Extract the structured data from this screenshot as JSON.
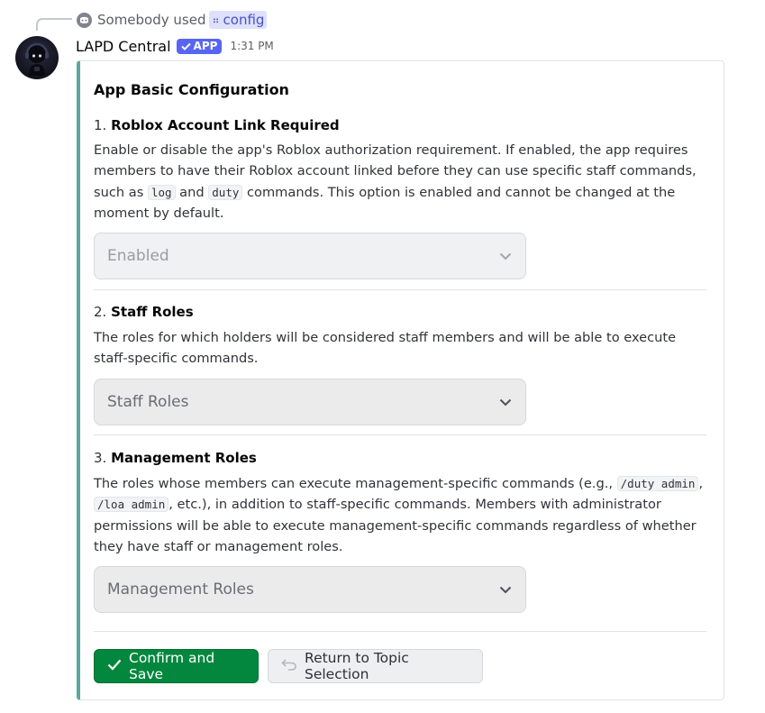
{
  "reply": {
    "text": "Somebody used",
    "command": "config"
  },
  "message": {
    "username": "LAPD Central",
    "app_tag": "APP",
    "timestamp": "1:31 PM"
  },
  "embed": {
    "accent_color": "#5aa89e",
    "title": "App Basic Configuration",
    "sections": [
      {
        "number": "1.",
        "heading": "Roblox Account Link Required",
        "text_parts": [
          "Enable or disable the app's Roblox authorization requirement. If enabled, the app requires members to have their Roblox account linked before they can use specific staff commands, such as ",
          "log",
          " and ",
          "duty",
          " commands. This option is enabled and cannot be changed at the moment by default."
        ],
        "select_value": "Enabled",
        "select_disabled": true
      },
      {
        "number": "2.",
        "heading": "Staff Roles",
        "text": "The roles for which holders will be considered staff members and will be able to execute staff-specific commands.",
        "select_placeholder": "Staff Roles"
      },
      {
        "number": "3.",
        "heading": "Management Roles",
        "text_parts": [
          "The roles whose members can execute management-specific commands (e.g., ",
          "/duty admin",
          ", ",
          "/loa admin",
          ", etc.), in addition to staff-specific commands. Members with administrator permissions will be able to execute management-specific commands regardless of whether they have staff or management roles."
        ],
        "select_placeholder": "Management Roles"
      }
    ]
  },
  "buttons": {
    "confirm": "Confirm and Save",
    "confirm_color": "#03873e",
    "return": "Return to Topic Selection"
  },
  "icons": {
    "reply_source": "discord-icon",
    "command": "app-command-icon",
    "confirm": "checkmark-icon",
    "return": "undo-arrow-icon",
    "dropdown": "chevron-down-icon"
  }
}
